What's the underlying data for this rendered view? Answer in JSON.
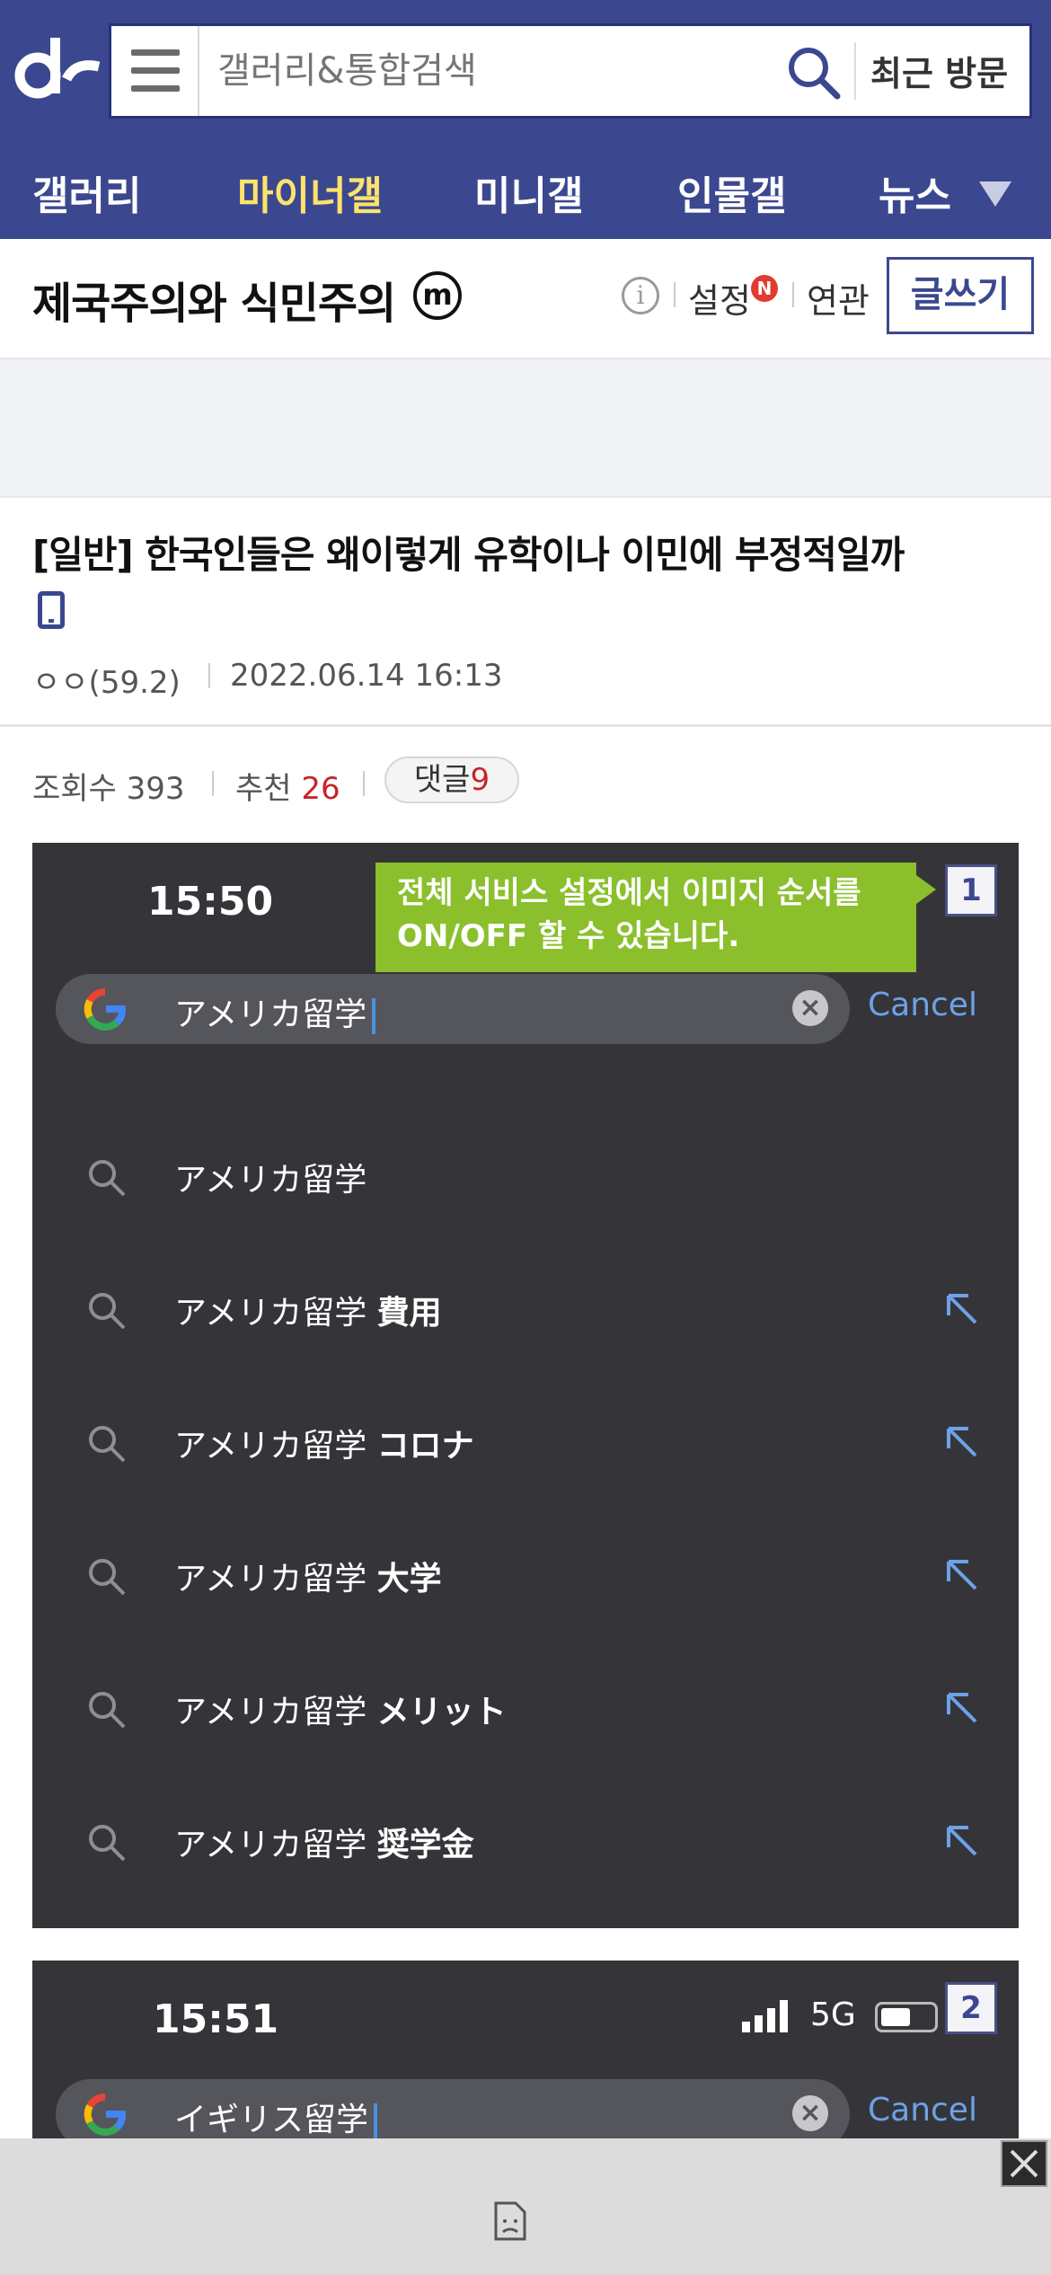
{
  "header": {
    "search_placeholder": "갤러리&통합검색",
    "recent_label": "최근 방문"
  },
  "nav": {
    "items": [
      "갤러리",
      "마이너갤",
      "미니갤",
      "인물갤",
      "뉴스"
    ],
    "active_index": 1
  },
  "gallery": {
    "title": "제국주의와 식민주의",
    "badge": "m",
    "setting_label": "설정",
    "setting_badge": "N",
    "related_label": "연관",
    "write_label": "글쓰기"
  },
  "post": {
    "title": "[일반] 한국인들은 왜이렇게 유학이나 이민에 부정적일까",
    "author": "ㅇㅇ(59.2)",
    "date": "2022.06.14 16:13",
    "views_label": "조회수",
    "views": "393",
    "recommend_label": "추천",
    "recommend": "26",
    "comment_label": "댓글",
    "comment_count": "9"
  },
  "tooltip": {
    "line1": "전체 서비스 설정에서 이미지 순서를",
    "line2": "ON/OFF 할 수 있습니다."
  },
  "image1": {
    "number": "1",
    "time": "15:50",
    "query": "アメリカ留学",
    "cancel": "Cancel",
    "suggestions": [
      {
        "prefix": "アメリカ留学",
        "suffix": ""
      },
      {
        "prefix": "アメリカ留学 ",
        "suffix": "費用"
      },
      {
        "prefix": "アメリカ留学 ",
        "suffix": "コロナ"
      },
      {
        "prefix": "アメリカ留学 ",
        "suffix": "大学"
      },
      {
        "prefix": "アメリカ留学 ",
        "suffix": "メリット"
      },
      {
        "prefix": "アメリカ留学 ",
        "suffix": "奨学金"
      }
    ]
  },
  "image2": {
    "number": "2",
    "time": "15:51",
    "network": "5G",
    "query": "イギリス留学",
    "cancel": "Cancel"
  },
  "colors": {
    "brand": "#3b4890",
    "nav_active": "#ffe26b",
    "accent_red": "#c8242b",
    "tooltip": "#8bbf2c"
  }
}
